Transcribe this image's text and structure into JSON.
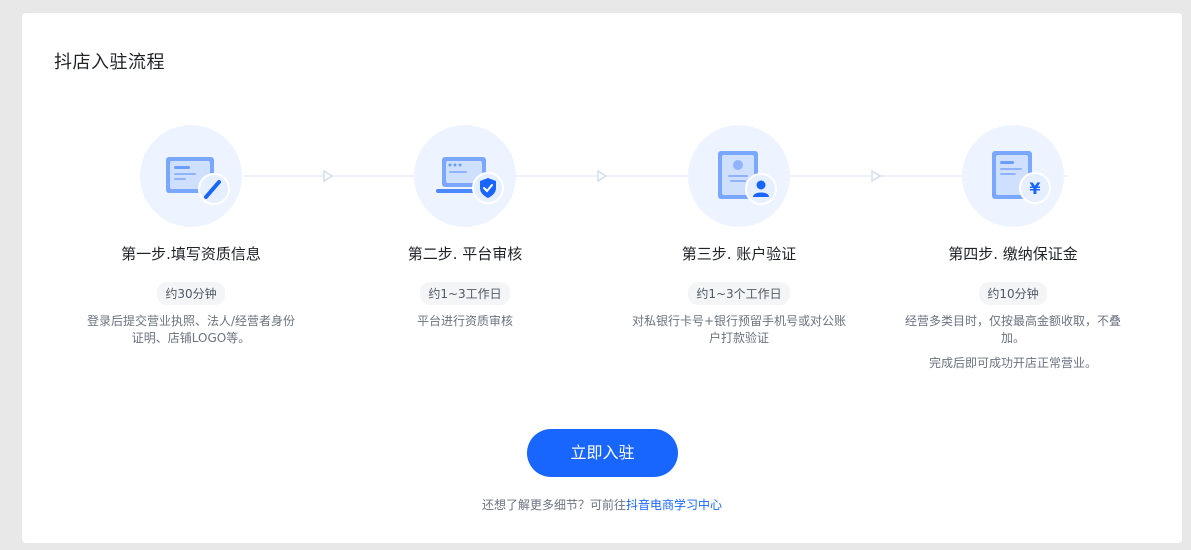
{
  "page_title": "抖店入驻流程",
  "steps": [
    {
      "title": "第一步.填写资质信息",
      "duration": "约30分钟",
      "desc": "登录后提交营业执照、法人/经营者身份证明、店铺LOGO等。",
      "desc2": "",
      "icon": "document-edit-icon"
    },
    {
      "title": "第二步. 平台审核",
      "duration": "约1~3工作日",
      "desc": "平台进行资质审核",
      "desc2": "",
      "icon": "laptop-shield-icon"
    },
    {
      "title": "第三步. 账户验证",
      "duration": "约1~3个工作日",
      "desc": "对私银行卡号+银行预留手机号或对公账户打款验证",
      "desc2": "",
      "icon": "id-card-user-icon"
    },
    {
      "title": "第四步. 缴纳保证金",
      "duration": "约10分钟",
      "desc": "经营多类目时，仅按最高金额收取，不叠加。",
      "desc2": "完成后即可成功开店正常营业。",
      "icon": "document-yen-icon"
    }
  ],
  "cta_label": "立即入驻",
  "footnote": {
    "prefix": "还想了解更多细节？可前往",
    "link": "抖音电商学习中心"
  },
  "colors": {
    "accent": "#1966ff",
    "icon_bg": "#eef4ff"
  }
}
